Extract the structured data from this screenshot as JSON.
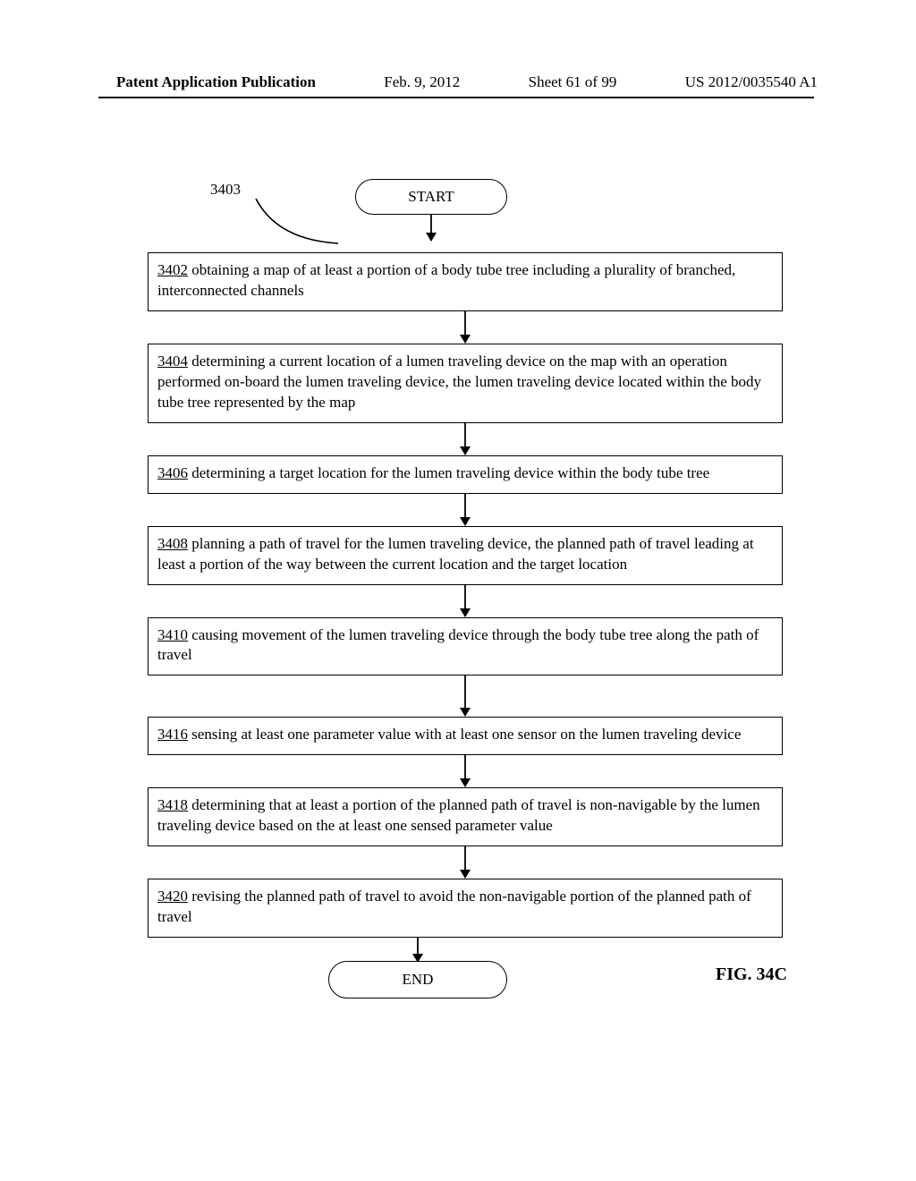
{
  "header": {
    "left": "Patent Application Publication",
    "center_date": "Feb. 9, 2012",
    "center_sheet": "Sheet 61 of 99",
    "right": "US 2012/0035540 A1"
  },
  "figure": {
    "ref_number": "3403",
    "start_label": "START",
    "end_label": "END",
    "fig_label": "FIG. 34C"
  },
  "steps": [
    {
      "num": "3402",
      "text": "  obtaining a map of at least a portion of a body tube tree including a plurality of branched, interconnected channels"
    },
    {
      "num": "3404",
      "text": "  determining a current location of a lumen traveling device on the map with an operation performed on-board the lumen traveling device, the lumen traveling device located within the body tube tree represented by the map"
    },
    {
      "num": "3406",
      "text": "  determining a target location for the lumen traveling device within the body tube tree"
    },
    {
      "num": "3408",
      "text": "  planning a path of travel for the lumen traveling device, the planned path of travel leading at least a portion of the way between the current location and the target location"
    },
    {
      "num": "3410",
      "text": "  causing movement of the lumen traveling device through the body tube tree along the path of travel"
    },
    {
      "num": "3416",
      "text": "  sensing at least one parameter value with at least one sensor on the lumen traveling device"
    },
    {
      "num": "3418",
      "text": "  determining that at least a portion of the planned path of travel is non-navigable by the lumen traveling device based on the at least one sensed parameter value"
    },
    {
      "num": "3420",
      "text": "  revising the planned path of travel to avoid the non-navigable portion of the planned path of travel"
    }
  ]
}
